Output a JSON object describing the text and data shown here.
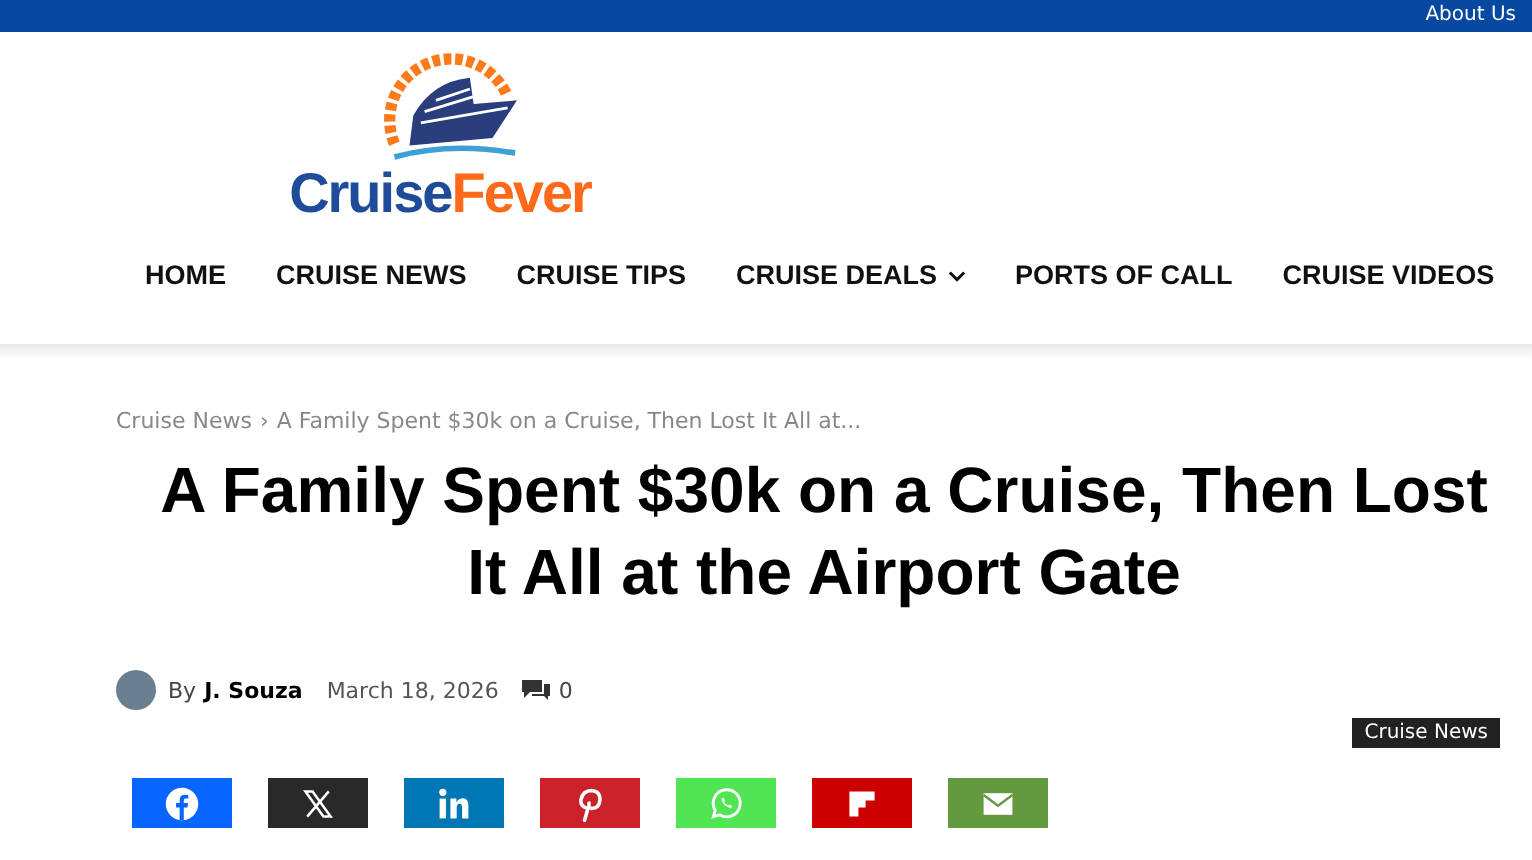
{
  "top_bar": {
    "links": [
      "About Us"
    ]
  },
  "logo": {
    "words": [
      "Cruise",
      "Fever"
    ]
  },
  "nav": [
    {
      "label": "HOME",
      "has_dropdown": false
    },
    {
      "label": "CRUISE NEWS",
      "has_dropdown": false
    },
    {
      "label": "CRUISE TIPS",
      "has_dropdown": false
    },
    {
      "label": "CRUISE DEALS",
      "has_dropdown": true
    },
    {
      "label": "PORTS OF CALL",
      "has_dropdown": false
    },
    {
      "label": "CRUISE VIDEOS",
      "has_dropdown": false
    }
  ],
  "breadcrumb": {
    "parent": "Cruise News",
    "separator": "›",
    "current": "A Family Spent $30k on a Cruise, Then Lost It All at..."
  },
  "article": {
    "title": "A Family Spent $30k on a Cruise, Then Lost It All at the Airport Gate",
    "by": "By",
    "author": "J. Souza",
    "date": "March 18, 2026",
    "comments": "0",
    "category": "Cruise News"
  },
  "share": [
    {
      "kind": "facebook",
      "color": "#0866ff"
    },
    {
      "kind": "x",
      "color": "#292929"
    },
    {
      "kind": "linkedin",
      "color": "#0077b5"
    },
    {
      "kind": "pinterest",
      "color": "#ca212a"
    },
    {
      "kind": "whatsapp",
      "color": "#4fe553"
    },
    {
      "kind": "flipboard",
      "color": "#cc0000"
    },
    {
      "kind": "email",
      "color": "#639a40"
    }
  ]
}
